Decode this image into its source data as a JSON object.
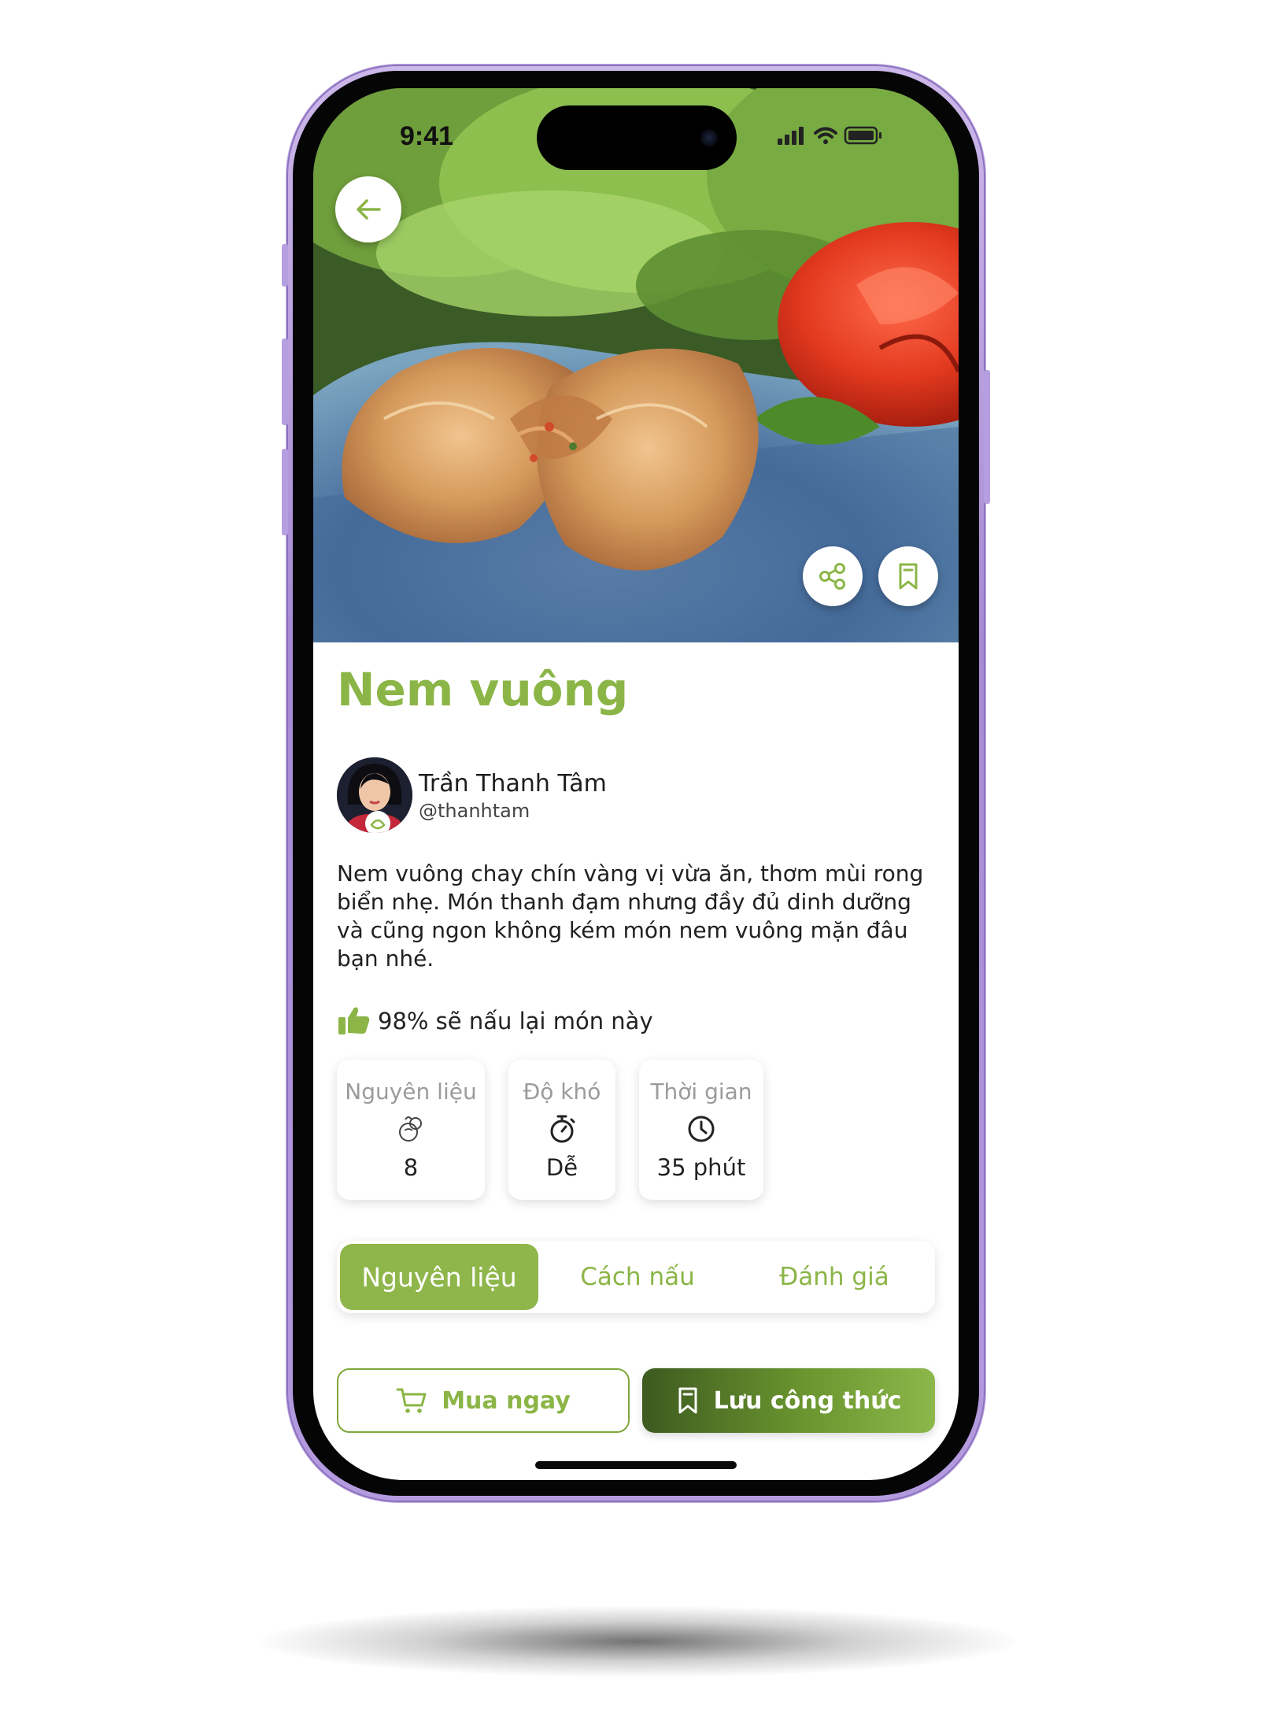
{
  "status_bar": {
    "time": "9:41"
  },
  "recipe": {
    "title": "Nem vuông",
    "author": {
      "name": "Trần Thanh Tâm",
      "handle": "@thanhtam"
    },
    "description": "Nem vuông chay chín vàng vị vừa ăn, thơm mùi rong biển nhẹ. Món thanh đạm nhưng đầy đủ dinh dưỡng và cũng ngon không kém món nem vuông mặn đâu bạn nhé.",
    "rating_text": "98% sẽ nấu lại món này"
  },
  "stats": [
    {
      "label": "Nguyên liệu",
      "value": "8",
      "icon": "ingredients-icon"
    },
    {
      "label": "Độ khó",
      "value": "Dễ",
      "icon": "stopwatch-icon"
    },
    {
      "label": "Thời gian",
      "value": "35 phút",
      "icon": "clock-icon"
    }
  ],
  "tabs": [
    {
      "label": "Nguyên liệu",
      "active": true
    },
    {
      "label": "Cách nấu",
      "active": false
    },
    {
      "label": "Đánh giá",
      "active": false
    }
  ],
  "actions": {
    "buy_label": "Mua ngay",
    "save_label": "Lưu công thức"
  },
  "colors": {
    "accent": "#8bb546",
    "accent_dark": "#3d5a1f",
    "phone_frame": "#b49bdf"
  }
}
